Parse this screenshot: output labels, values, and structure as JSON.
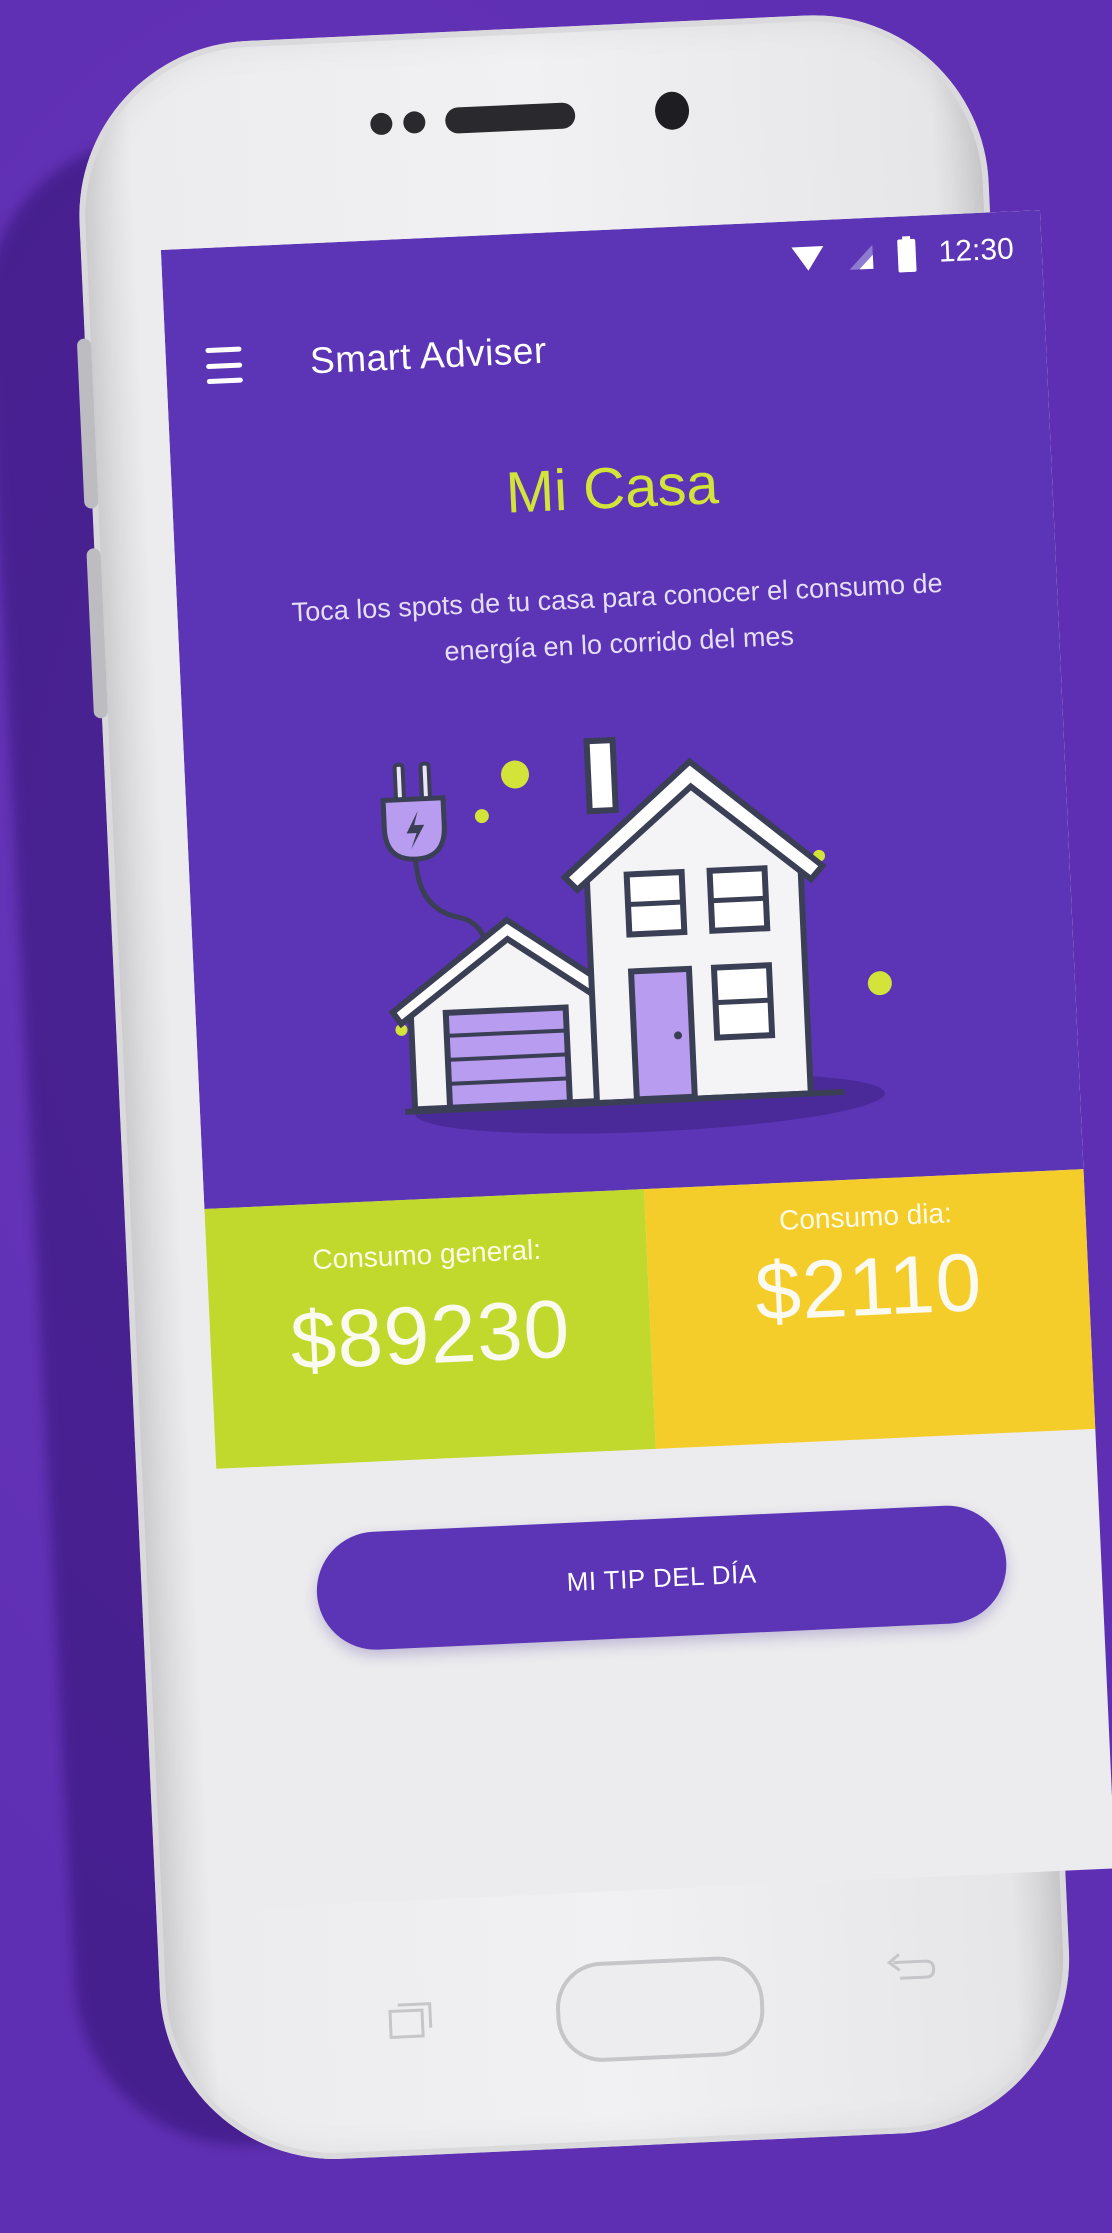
{
  "status_bar": {
    "time": "12:30",
    "icons": [
      "wifi-icon",
      "signal-icon",
      "battery-icon"
    ]
  },
  "app_bar": {
    "menu_icon": "menu-icon",
    "title": "Smart Adviser"
  },
  "home": {
    "title": "Mi Casa",
    "description": "Toca los spots de tu casa para conocer el consumo de energía en lo corrido del mes",
    "illustration": "house-illustration"
  },
  "stats": {
    "general": {
      "label": "Consumo general:",
      "value": "$89230"
    },
    "day": {
      "label": "Consumo dia:",
      "value": "$2110"
    }
  },
  "actions": {
    "tip_button": "MI TIP DEL DÍA"
  },
  "colors": {
    "background": "#5f2fb3",
    "primary": "#5b35b5",
    "title_accent": "#d4e33a",
    "general_panel": "#c1d92c",
    "day_panel": "#f5cd2b",
    "screen_bg": "#ececee"
  }
}
